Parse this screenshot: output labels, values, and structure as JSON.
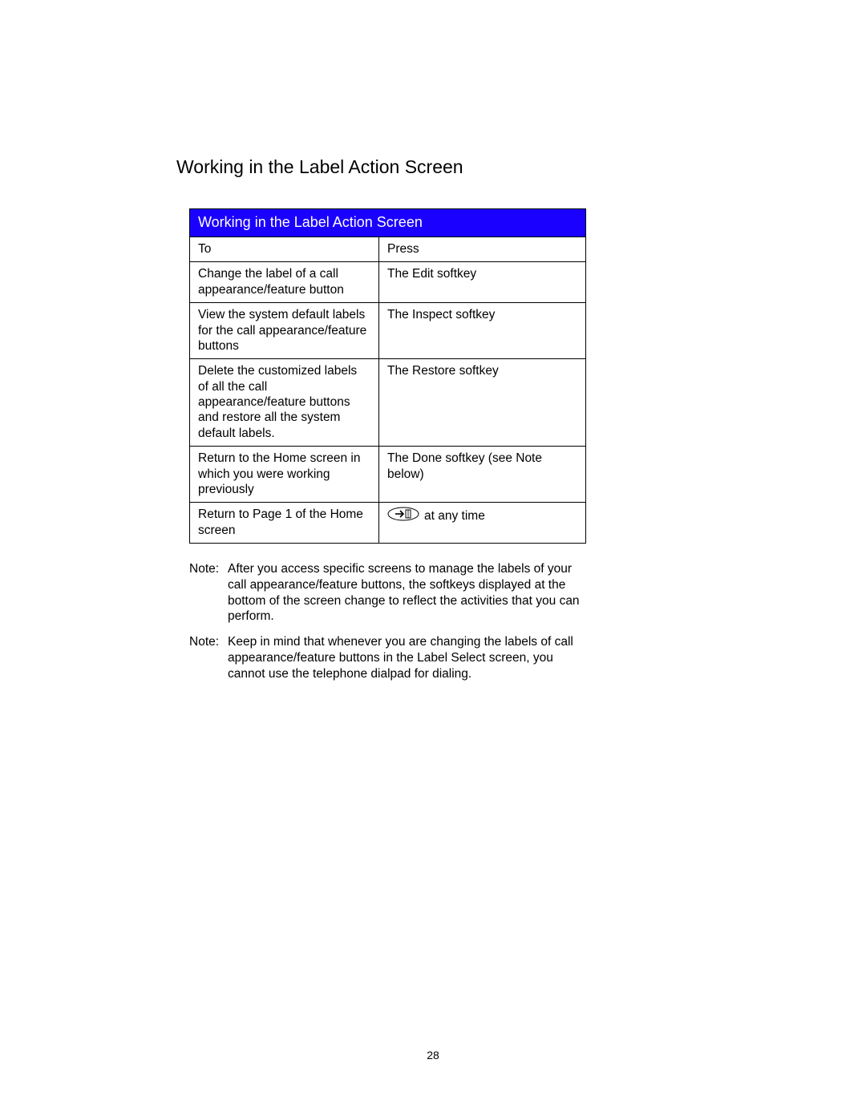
{
  "heading": "Working in the Label Action Screen",
  "table": {
    "title": "Working in the Label Action Screen",
    "head": {
      "left": "To",
      "right": "Press"
    },
    "rows": [
      {
        "left": "Change the label of a call appearance/feature button",
        "right": "The Edit softkey"
      },
      {
        "left": "View the system default labels for the call appearance/feature buttons",
        "right": "The Inspect softkey"
      },
      {
        "left": "Delete the customized labels of all the call appearance/feature buttons and restore all the system default labels.",
        "right": "The Restore softkey"
      },
      {
        "left": "Return to the Home screen in which you were working previously",
        "right": "The Done softkey (see Note below)"
      },
      {
        "left": "Return to Page 1 of the Home screen",
        "right_suffix": "at any time",
        "icon": "exit-button-icon"
      }
    ]
  },
  "notes": [
    {
      "label": "Note:",
      "body": "After you access specific screens to manage the labels of your call appearance/feature buttons, the softkeys displayed at the bottom of the screen change to reflect the activities that you can perform."
    },
    {
      "label": "Note:",
      "body": "Keep in mind that whenever you are changing the labels of call appearance/feature buttons in the Label Select screen, you cannot use the telephone dialpad for dialing."
    }
  ],
  "page_number": "28"
}
